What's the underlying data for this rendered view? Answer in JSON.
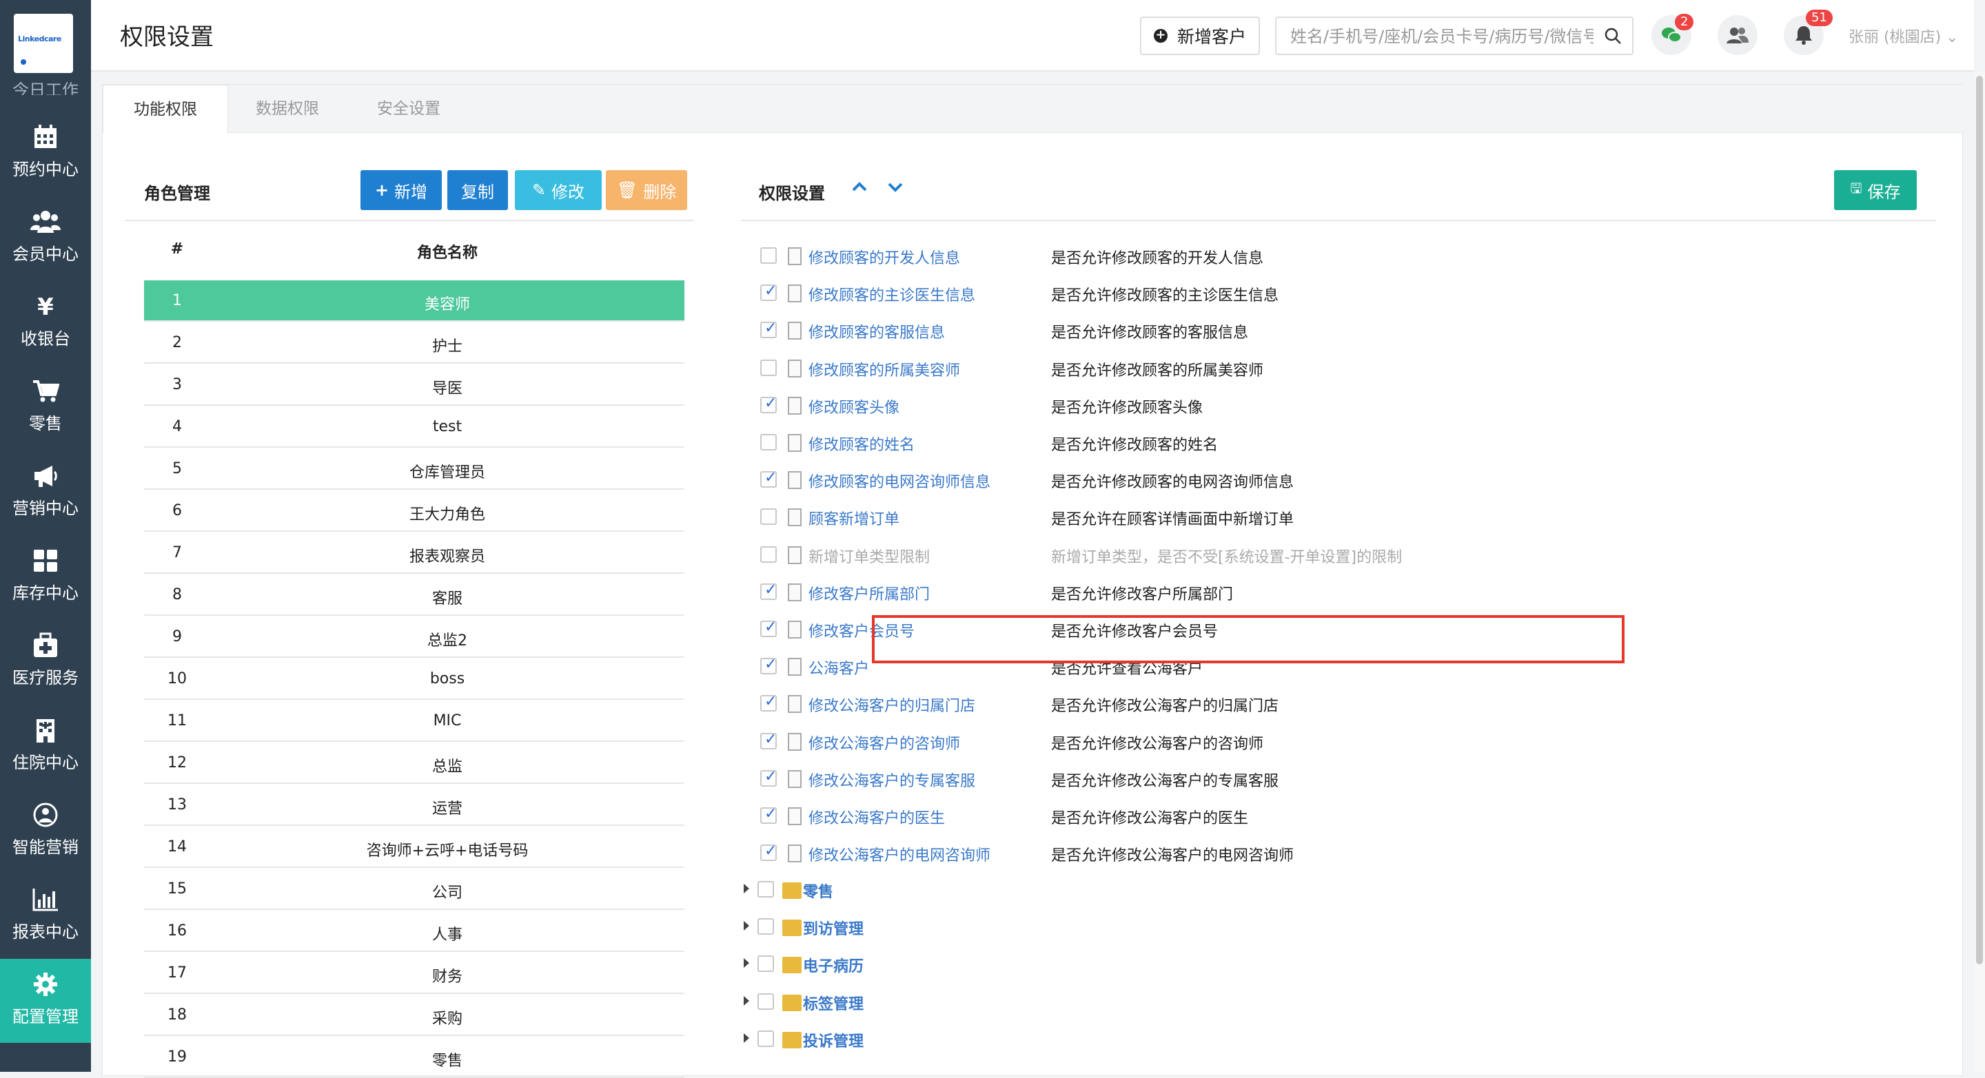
{
  "sidebar": {
    "logo_text": "Linkedcare",
    "cut_label": "今日工作",
    "items": [
      {
        "label": "预约中心",
        "icon": "calendar-icon"
      },
      {
        "label": "会员中心",
        "icon": "users-icon"
      },
      {
        "label": "收银台",
        "icon": "yen-icon"
      },
      {
        "label": "零售",
        "icon": "cart-icon"
      },
      {
        "label": "营销中心",
        "icon": "megaphone-icon"
      },
      {
        "label": "库存中心",
        "icon": "grid-icon"
      },
      {
        "label": "医疗服务",
        "icon": "medkit-icon"
      },
      {
        "label": "住院中心",
        "icon": "building-icon"
      },
      {
        "label": "智能营销",
        "icon": "brain-icon"
      },
      {
        "label": "报表中心",
        "icon": "barchart-icon"
      },
      {
        "label": "配置管理",
        "icon": "gear-icon",
        "active": true
      }
    ]
  },
  "header": {
    "title": "权限设置",
    "add_customer": "新增客户",
    "search_placeholder": "姓名/手机号/座机/会员卡号/病历号/微信号",
    "wechat_badge": "2",
    "notify_badge": "51",
    "user": "张丽 (桃園店)"
  },
  "tabs": [
    "功能权限",
    "数据权限",
    "安全设置"
  ],
  "roles": {
    "title": "角色管理",
    "buttons": {
      "add": "新增",
      "copy": "复制",
      "edit": "修改",
      "delete": "删除"
    },
    "col_num": "#",
    "col_name": "角色名称",
    "rows": [
      {
        "n": "1",
        "name": "美容师"
      },
      {
        "n": "2",
        "name": "护士"
      },
      {
        "n": "3",
        "name": "导医"
      },
      {
        "n": "4",
        "name": "test"
      },
      {
        "n": "5",
        "name": "仓库管理员"
      },
      {
        "n": "6",
        "name": "王大力角色"
      },
      {
        "n": "7",
        "name": "报表观察员"
      },
      {
        "n": "8",
        "name": "客服"
      },
      {
        "n": "9",
        "name": "总监2"
      },
      {
        "n": "10",
        "name": "boss"
      },
      {
        "n": "11",
        "name": "MIC"
      },
      {
        "n": "12",
        "name": "总监"
      },
      {
        "n": "13",
        "name": "运营"
      },
      {
        "n": "14",
        "name": "咨询师+云呼+电话号码"
      },
      {
        "n": "15",
        "name": "公司"
      },
      {
        "n": "16",
        "name": "人事"
      },
      {
        "n": "17",
        "name": "财务"
      },
      {
        "n": "18",
        "name": "采购"
      },
      {
        "n": "19",
        "name": "零售"
      }
    ]
  },
  "perms": {
    "title": "权限设置",
    "save": "保存",
    "items": [
      {
        "name": "修改顾客的开发人信息",
        "desc": "是否允许修改顾客的开发人信息",
        "checked": false
      },
      {
        "name": "修改顾客的主诊医生信息",
        "desc": "是否允许修改顾客的主诊医生信息",
        "checked": true
      },
      {
        "name": "修改顾客的客服信息",
        "desc": "是否允许修改顾客的客服信息",
        "checked": true
      },
      {
        "name": "修改顾客的所属美容师",
        "desc": "是否允许修改顾客的所属美容师",
        "checked": false
      },
      {
        "name": "修改顾客头像",
        "desc": "是否允许修改顾客头像",
        "checked": true
      },
      {
        "name": "修改顾客的姓名",
        "desc": "是否允许修改顾客的姓名",
        "checked": false
      },
      {
        "name": "修改顾客的电网咨询师信息",
        "desc": "是否允许修改顾客的电网咨询师信息",
        "checked": true
      },
      {
        "name": "顾客新增订单",
        "desc": "是否允许在顾客详情画面中新增订单",
        "checked": false
      },
      {
        "name": "新增订单类型限制",
        "desc": "新增订单类型，是否不受[系统设置-开单设置]的限制",
        "checked": false,
        "dim": true
      },
      {
        "name": "修改客户所属部门",
        "desc": "是否允许修改客户所属部门",
        "checked": true
      },
      {
        "name": "修改客户会员号",
        "desc": "是否允许修改客户会员号",
        "checked": true
      },
      {
        "name": "公海客户",
        "desc": "是否允许查看公海客户",
        "checked": true
      },
      {
        "name": "修改公海客户的归属门店",
        "desc": "是否允许修改公海客户的归属门店",
        "checked": true
      },
      {
        "name": "修改公海客户的咨询师",
        "desc": "是否允许修改公海客户的咨询师",
        "checked": true
      },
      {
        "name": "修改公海客户的专属客服",
        "desc": "是否允许修改公海客户的专属客服",
        "checked": true
      },
      {
        "name": "修改公海客户的医生",
        "desc": "是否允许修改公海客户的医生",
        "checked": true
      },
      {
        "name": "修改公海客户的电网咨询师",
        "desc": "是否允许修改公海客户的电网咨询师",
        "checked": true
      }
    ],
    "groups": [
      "零售",
      "到访管理",
      "电子病历",
      "标签管理",
      "投诉管理"
    ]
  },
  "colors": {
    "sidebar": "#2f4050",
    "accent": "#22b8a6",
    "selected_row": "#4ec99c",
    "primary": "#1f7fd1",
    "info": "#39bde0",
    "warning": "#f7b46b",
    "highlight": "#e5372c"
  }
}
